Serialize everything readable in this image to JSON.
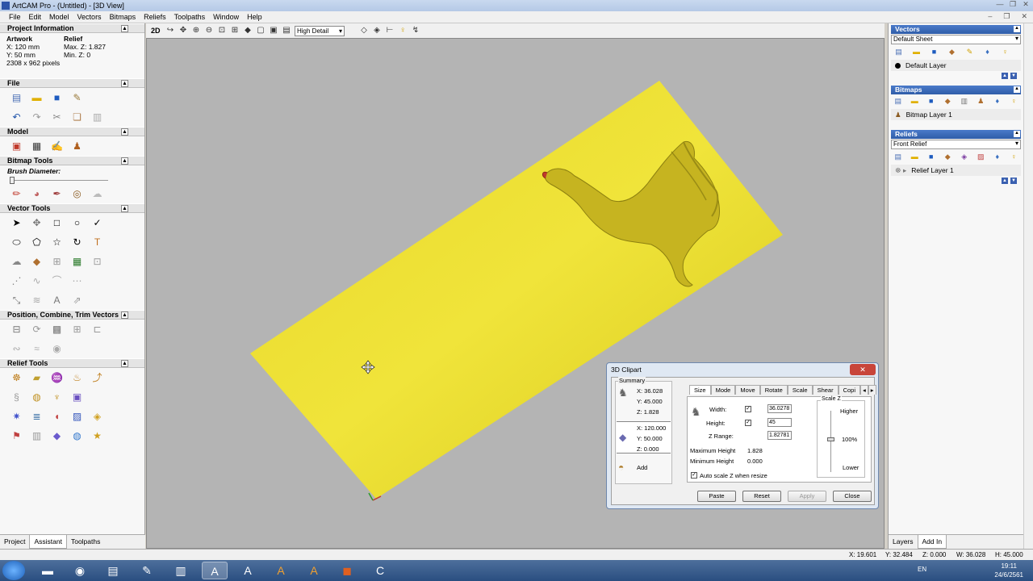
{
  "window": {
    "title": "ArtCAM Pro - (Untitled) - [3D View]"
  },
  "menu": [
    "File",
    "Edit",
    "Model",
    "Vectors",
    "Bitmaps",
    "Reliefs",
    "Toolpaths",
    "Window",
    "Help"
  ],
  "left": {
    "project_info": {
      "heading": "Project Information",
      "artwork_label": "Artwork",
      "relief_label": "Relief",
      "x": "X: 120 mm",
      "y": "Y: 50 mm",
      "pixels": "2308 x 962 pixels",
      "max_z": "Max. Z: 1.827",
      "min_z": "Min. Z: 0"
    },
    "sections": {
      "file": "File",
      "model": "Model",
      "bitmap_tools": "Bitmap Tools",
      "brush_diameter": "Brush Diameter:",
      "vector_tools": "Vector Tools",
      "position_tools": "Position, Combine, Trim Vectors",
      "relief_tools": "Relief Tools"
    },
    "tabs": [
      "Project",
      "Assistant",
      "Toolpaths"
    ]
  },
  "view_toolbar": {
    "mode_label": "2D",
    "quality": "High Detail"
  },
  "right": {
    "vectors": {
      "heading": "Vectors",
      "sheet": "Default Sheet",
      "layer": "Default Layer"
    },
    "bitmaps": {
      "heading": "Bitmaps",
      "layer": "Bitmap Layer 1"
    },
    "reliefs": {
      "heading": "Reliefs",
      "sheet": "Front Relief",
      "layer": "Relief Layer 1"
    },
    "tabs": [
      "Layers",
      "Add In"
    ]
  },
  "status": {
    "x": "X: 19.601",
    "y": "Y: 32.484",
    "z": "Z: 0.000",
    "w": "W: 36.028",
    "h": "H: 45.000"
  },
  "taskbar": {
    "lang": "EN",
    "time": "19:11",
    "date": "24/6/2561"
  },
  "clipart": {
    "title": "3D Clipart",
    "summary_label": "Summary",
    "sum_x": "X:  36.028",
    "sum_y": "Y:  45.000",
    "sum_z": "Z:  1.828",
    "pos_x": "X:  120.000",
    "pos_y": "Y:  50.000",
    "pos_z": "Z:  0.000",
    "add": "Add",
    "tabs": [
      "Size",
      "Mode",
      "Move",
      "Rotate",
      "Scale",
      "Shear",
      "Copi"
    ],
    "width_label": "Width:",
    "height_label": "Height:",
    "zrange_label": "Z Range:",
    "width_value": "36.0278",
    "height_value": "45",
    "zrange_value": "1.82781",
    "max_height_label": "Maximum Height",
    "max_height_value": "1.828",
    "min_height_label": "Minimum Height",
    "min_height_value": "0.000",
    "auto_scale": "Auto scale Z when resize",
    "scale_z_label": "Scale Z",
    "higher": "Higher",
    "pct": "100%",
    "lower": "Lower",
    "buttons": {
      "paste": "Paste",
      "reset": "Reset",
      "apply": "Apply",
      "close": "Close"
    }
  }
}
